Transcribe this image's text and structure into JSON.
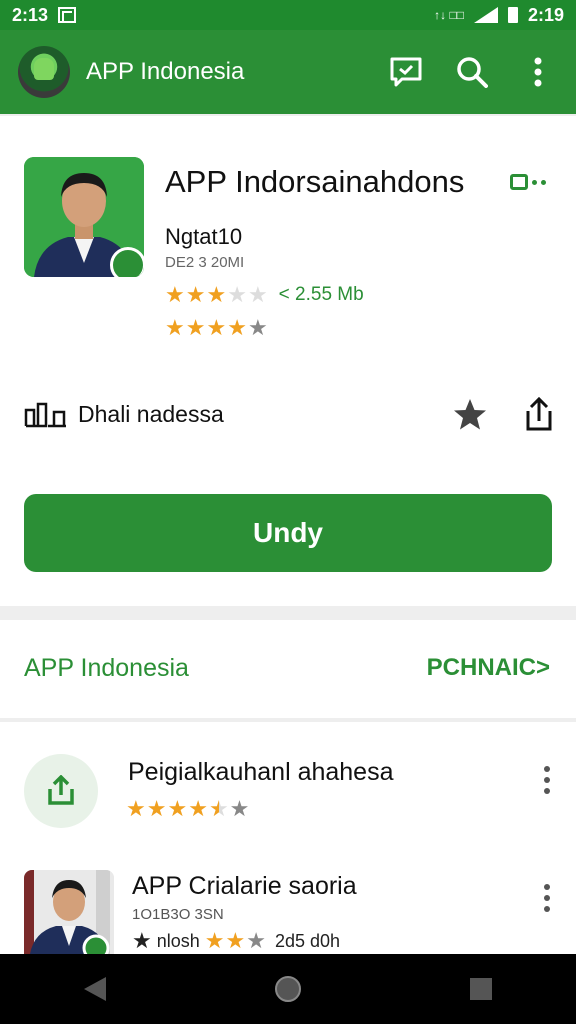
{
  "status_bar": {
    "time_left": "2:13",
    "time_right": "2:19",
    "signal_text": "↑↓ □□"
  },
  "app_bar": {
    "title": "APP Indonesia"
  },
  "app_card": {
    "name": "APP Indorsainahdons",
    "developer": "Ngtat10",
    "version": "DE2 3 20MI",
    "rating_stars": 3,
    "size": "< 2.55 Mb",
    "rating2_stars": 4.5,
    "info_label": "Dhali nadessa",
    "install_label": "Undy"
  },
  "section": {
    "title": "APP Indonesia",
    "action": "PCHNAIC>"
  },
  "list": [
    {
      "title": "Peigialkauhanl ahahesa",
      "rating_stars": 4.5
    },
    {
      "title": "APP Crialarie saoria",
      "subtitle": "1O1B3O 3SN",
      "meta": "nlosh",
      "size": "2d5 d0h"
    }
  ],
  "colors": {
    "accent": "#2b8f36",
    "star": "#f0a020"
  }
}
